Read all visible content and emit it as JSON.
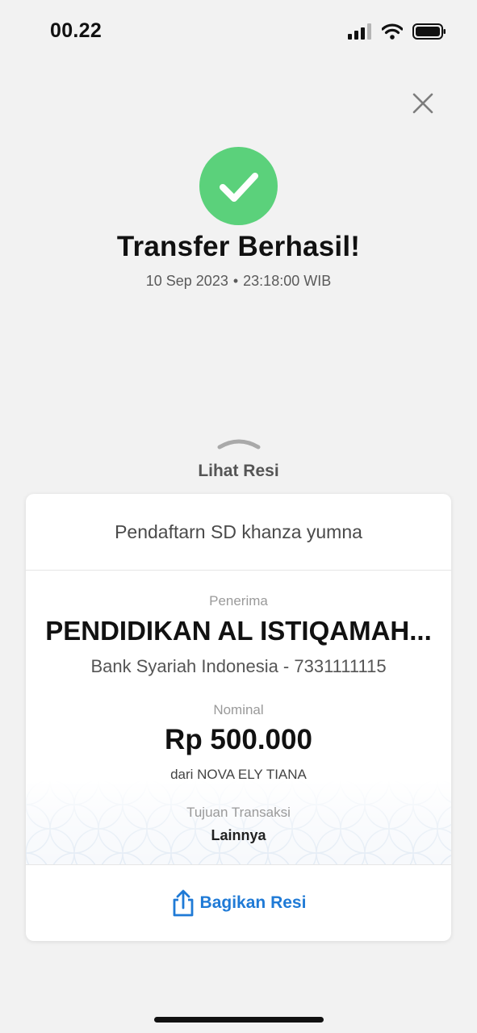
{
  "status_bar": {
    "time": "00.22",
    "icons": [
      "cellular-signal-icon",
      "wifi-icon",
      "battery-icon"
    ]
  },
  "header": {
    "close_icon": "close-icon",
    "success_icon": "checkmark-icon",
    "title": "Transfer Berhasil!",
    "date": "10 Sep 2023",
    "separator": "•",
    "time": "23:18:00 WIB"
  },
  "receipt_toggle": {
    "icon": "chevron-up-icon",
    "label": "Lihat Resi"
  },
  "receipt": {
    "note": "Pendaftarn SD khanza yumna",
    "recipient_label": "Penerima",
    "recipient_name": "PENDIDIKAN AL ISTIQAMAH...",
    "recipient_bank": "Bank Syariah Indonesia - 7331111115",
    "amount_label": "Nominal",
    "amount": "Rp 500.000",
    "sender": "dari NOVA ELY TIANA",
    "purpose_label": "Tujuan Transaksi",
    "purpose": "Lainnya",
    "share_label": "Bagikan Resi",
    "share_icon": "share-icon"
  },
  "colors": {
    "success": "#5bd17b",
    "accent": "#1f7ad6",
    "background": "#f2f2f2"
  }
}
